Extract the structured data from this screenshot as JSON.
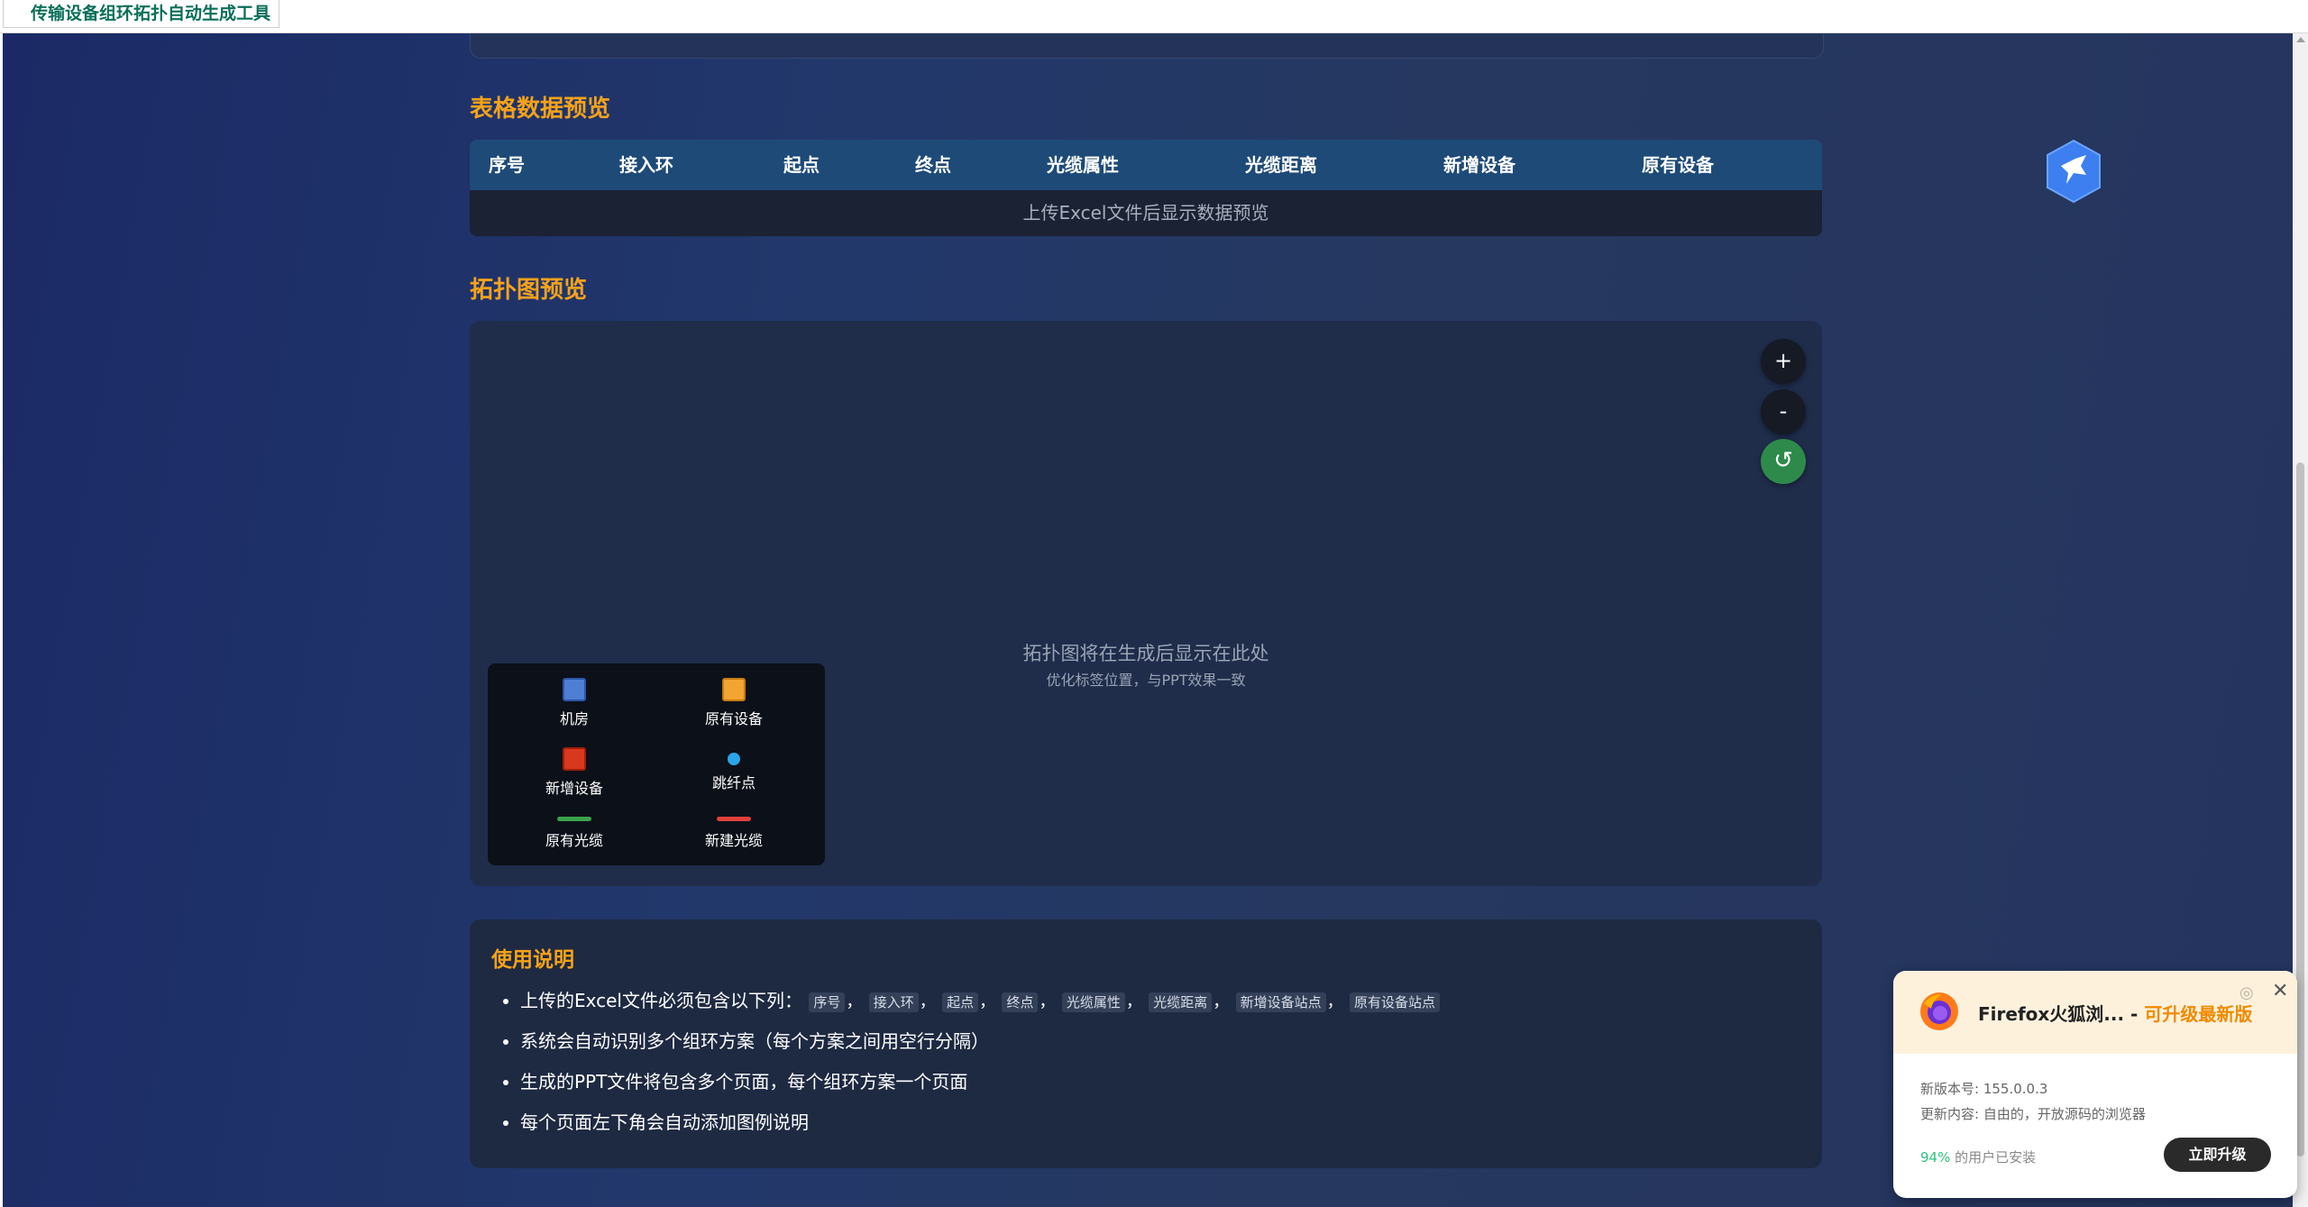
{
  "browser": {
    "tab_title": "传输设备组环拓扑自动生成工具"
  },
  "table_section": {
    "title": "表格数据预览",
    "headers": [
      "序号",
      "接入环",
      "起点",
      "终点",
      "光缆属性",
      "光缆距离",
      "新增设备",
      "原有设备"
    ],
    "empty_text": "上传Excel文件后显示数据预览"
  },
  "topology": {
    "title": "拓扑图预览",
    "zoom_in": "+",
    "zoom_out": "-",
    "reset": "↺",
    "placeholder": "拓扑图将在生成后显示在此处",
    "placeholder_sub": "优化标签位置，与PPT效果一致",
    "legend": [
      {
        "label": "机房",
        "icon": "server-room-icon"
      },
      {
        "label": "原有设备",
        "icon": "existing-device-icon"
      },
      {
        "label": "新增设备",
        "icon": "new-device-icon"
      },
      {
        "label": "跳纤点",
        "icon": "splice-point-icon"
      },
      {
        "label": "原有光缆",
        "icon": "existing-cable-icon",
        "color": "#3aa34a"
      },
      {
        "label": "新建光缆",
        "icon": "new-cable-icon",
        "color": "#e0413a"
      }
    ]
  },
  "usage": {
    "title": "使用说明",
    "items": [
      "上传的Excel文件必须包含以下列：",
      "系统会自动识别多个组环方案（每个方案之间用空行分隔）",
      "生成的PPT文件将包含多个页面，每个组环方案一个页面",
      "每个页面左下角会自动添加图例说明"
    ],
    "required_columns": [
      "序号",
      "接入环",
      "起点",
      "终点",
      "光缆属性",
      "光缆距离",
      "新增设备站点",
      "原有设备站点"
    ],
    "separator": "，"
  },
  "popup": {
    "title": "Firefox火狐浏...",
    "title_dash": " - ",
    "highlight": "可升级最新版",
    "version_line": "新版本号: 155.0.0.3",
    "content_line": "更新内容: 自由的，开放源码的浏览器",
    "percent": "94%",
    "percent_text": " 的用户已安装",
    "button": "立即升级",
    "close": "✕",
    "settings": "◎"
  },
  "colors": {
    "accent_title": "#f5a21b",
    "table_header": "#1e4a78",
    "reset_button": "#2e8a4a"
  }
}
